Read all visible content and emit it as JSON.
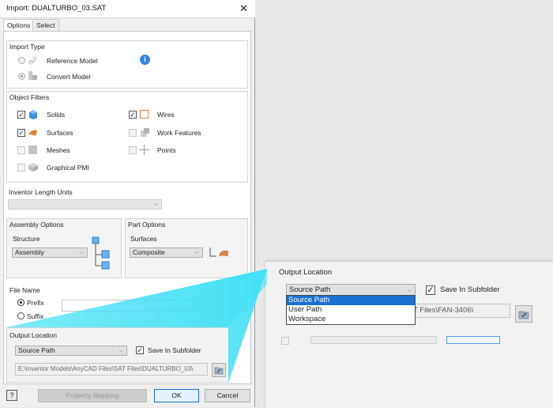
{
  "dialog": {
    "title": "Import:  DUALTURBO_03.SAT",
    "close_glyph": "✕",
    "tabs": [
      "Options",
      "Select"
    ]
  },
  "import_type": {
    "heading": "Import Type",
    "reference_model": "Reference Model",
    "convert_model": "Convert Model",
    "info_glyph": "i"
  },
  "object_filters": {
    "heading": "Object Filters",
    "solids": "Solids",
    "wires": "Wires",
    "surfaces": "Surfaces",
    "work_features": "Work Features",
    "meshes": "Meshes",
    "points": "Points",
    "graphical_pmi": "Graphical PMI"
  },
  "length_units": {
    "heading": "Inventor Length Units",
    "value": ""
  },
  "assembly_options": {
    "heading": "Assembly Options",
    "structure_label": "Structure",
    "structure_value": "Assembly"
  },
  "part_options": {
    "heading": "Part Options",
    "surfaces_label": "Surfaces",
    "surfaces_value": "Composite"
  },
  "file_name": {
    "heading": "File Name",
    "prefix": "Prefix",
    "suffix": "Suffix",
    "value": ""
  },
  "output_location": {
    "heading": "Output Location",
    "source_value": "Source Path",
    "save_in_subfolder": "Save In Subfolder",
    "path": "E:\\Inventor Models\\AnyCAD Files\\SAT Files\\DUALTURBO_03\\"
  },
  "footer": {
    "help_glyph": "?",
    "property_mapping": "Property Mapping",
    "ok": "OK",
    "cancel": "Cancel"
  },
  "zoom_panel": {
    "heading": "Output Location",
    "combo_value": "Source Path",
    "save_in_subfolder": "Save In Subfolder",
    "options": [
      "Source Path",
      "User Path",
      "Workspace"
    ],
    "path_fragment": "T Files\\FAN-3406\\"
  },
  "colors": {
    "accent": "#1a6fd0",
    "beam": "#3fe0f5",
    "solid_blue": "#3d8fe0",
    "wire_orange": "#e8803a"
  }
}
